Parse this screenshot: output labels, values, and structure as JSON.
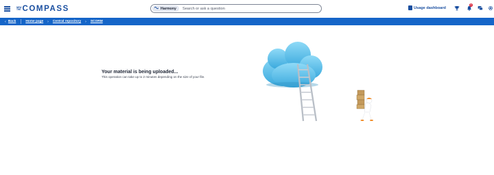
{
  "header": {
    "menu_icon": "hamburger-icon",
    "logo": {
      "small_lines": [
        "NEW",
        "THE"
      ],
      "text": "COMPASS"
    },
    "search": {
      "chip_label": "Harmony",
      "placeholder": "Search or ask a question",
      "chip_icon": "harmony-icon"
    },
    "usage_dashboard_label": "Usage dashboard",
    "notification_count": "1",
    "icons": [
      "clipboard-icon",
      "trophy-icon",
      "bell-icon",
      "chat-icon",
      "gear-icon"
    ]
  },
  "breadcrumb": {
    "back_label": "Back",
    "items": [
      "Home page",
      "Central repository",
      "SCORM"
    ]
  },
  "main": {
    "title": "Your material is being uploaded...",
    "subtitle": "This operation can take up to 2 minutes depending on the size of your file."
  },
  "colors": {
    "brand": "#1a4fa0",
    "breadcrumb_bar": "#1565c8",
    "cloud": "#5cc3ec",
    "badge": "#d9263b"
  }
}
